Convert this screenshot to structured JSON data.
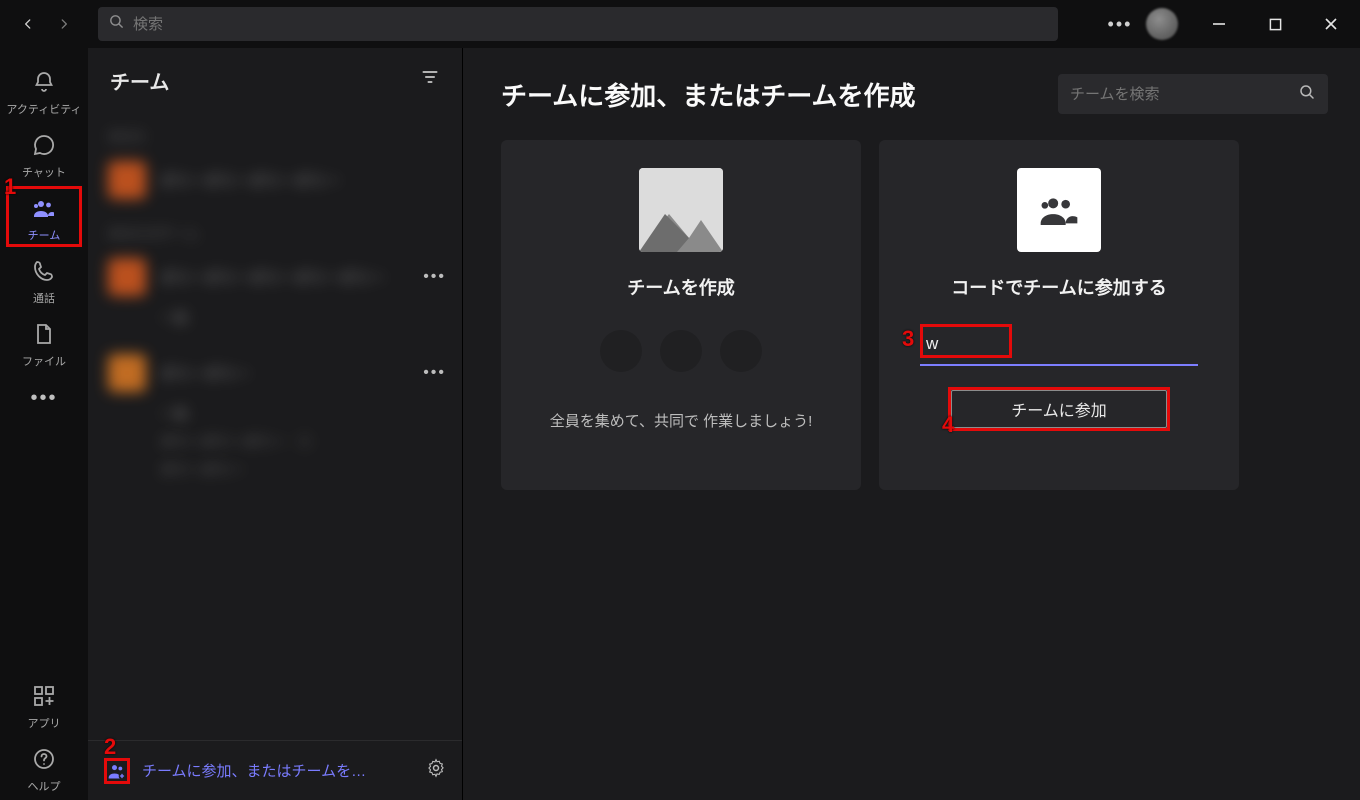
{
  "titlebar": {
    "search_placeholder": "検索"
  },
  "rail": {
    "items": [
      {
        "id": "activity",
        "label": "アクティビティ"
      },
      {
        "id": "chat",
        "label": "チャット"
      },
      {
        "id": "teams",
        "label": "チーム"
      },
      {
        "id": "calls",
        "label": "通話"
      },
      {
        "id": "files",
        "label": "ファイル"
      }
    ],
    "apps_label": "アプリ",
    "help_label": "ヘルプ"
  },
  "sidebar": {
    "title": "チーム",
    "join_create_link": "チームに参加、またはチームを…"
  },
  "main": {
    "heading": "チームに参加、またはチームを作成",
    "search_placeholder": "チームを検索",
    "cards": {
      "create": {
        "title": "チームを作成",
        "subtitle": "全員を集めて、共同で 作業しましょう!"
      },
      "join_code": {
        "title": "コードでチームに参加する",
        "code_value": "w",
        "button": "チームに参加"
      }
    }
  },
  "callouts": {
    "c1": "1",
    "c2": "2",
    "c3": "3",
    "c4": "4"
  }
}
